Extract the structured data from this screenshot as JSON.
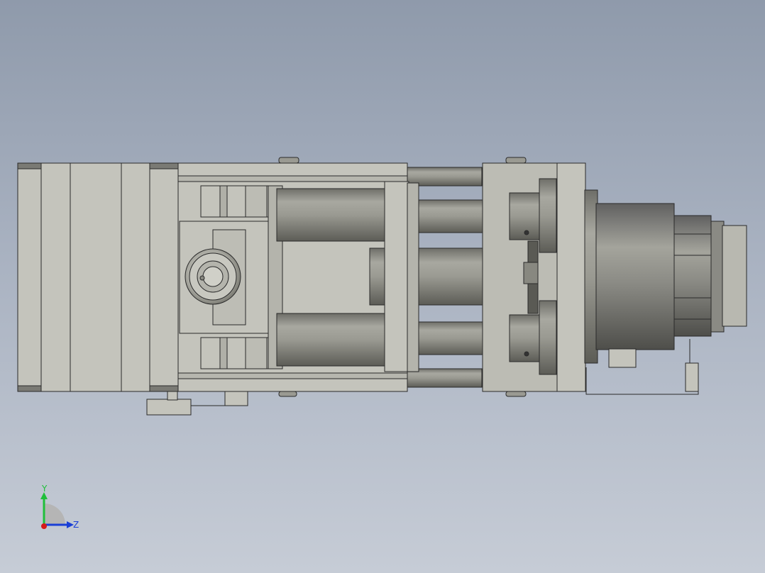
{
  "viewport": {
    "background_top": "#8f9aab",
    "background_bottom": "#c6ccd6"
  },
  "model": {
    "body_color": "#c4c4bc",
    "cylinder_color": "#8e8e86",
    "edge_color": "#2a2a2a"
  },
  "triad": {
    "y_label": "Y",
    "z_label": "Z",
    "y_color": "#1fbf3a",
    "z_color": "#1a3fd6",
    "x_color": "#d61a1a"
  }
}
